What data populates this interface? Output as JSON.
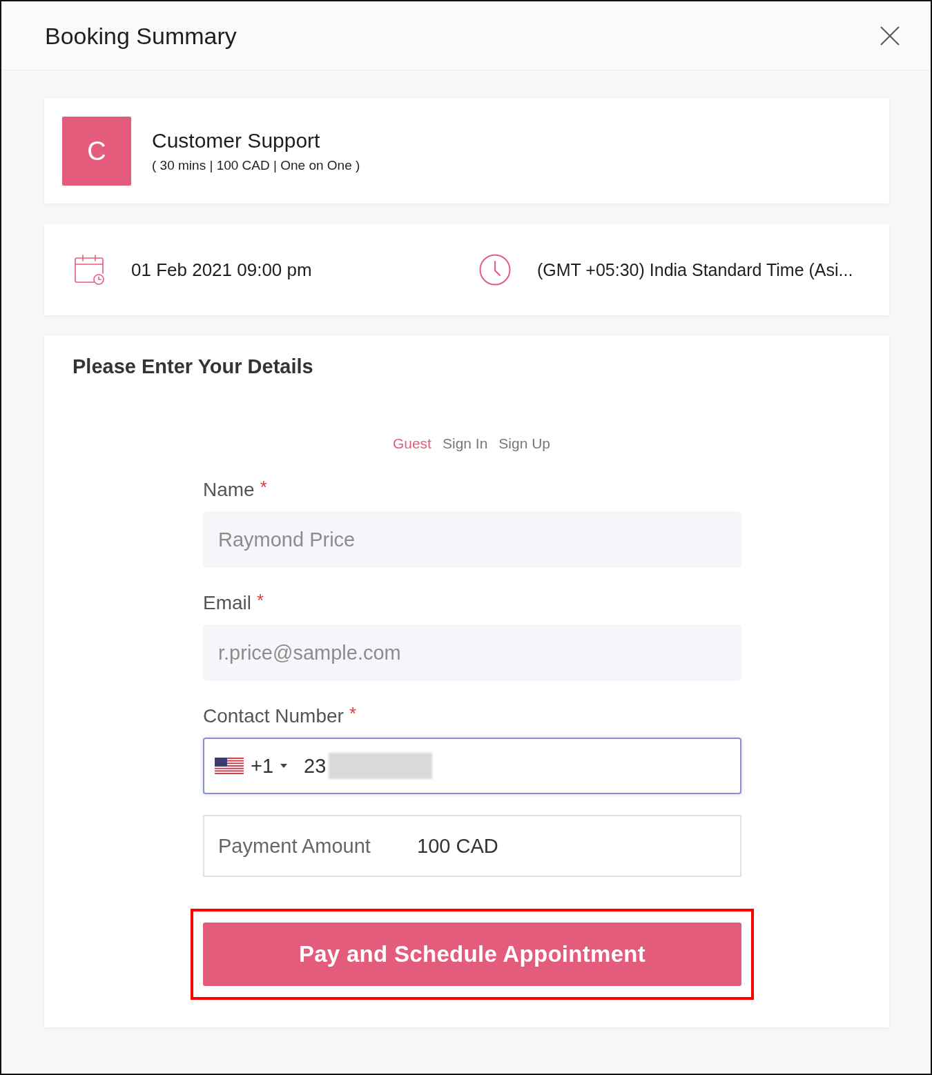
{
  "dialog": {
    "title": "Booking Summary"
  },
  "service": {
    "avatar_letter": "C",
    "name": "Customer Support",
    "details": "( 30 mins | 100 CAD | One on One )"
  },
  "schedule": {
    "date_time": "01 Feb 2021 09:00 pm",
    "timezone": "(GMT +05:30) India Standard Time (Asi..."
  },
  "details_form": {
    "heading": "Please Enter Your Details",
    "tabs": [
      {
        "label": "Guest",
        "selected": true
      },
      {
        "label": "Sign In",
        "selected": false
      },
      {
        "label": "Sign Up",
        "selected": false
      }
    ],
    "fields": [
      {
        "kind": "text",
        "label": "Name",
        "required_mark": "*",
        "placeholder": "Raymond Price"
      },
      {
        "kind": "text",
        "label": "Email",
        "required_mark": "*",
        "placeholder": "r.price@sample.com"
      },
      {
        "kind": "phone",
        "label": "Contact Number",
        "required_mark": "*",
        "dial_code": "+1",
        "value": "23",
        "focused": true,
        "redacted": true
      }
    ],
    "payment": {
      "label": "Payment Amount",
      "amount": "100 CAD"
    },
    "submit_button": {
      "label": "Pay and Schedule Appointment",
      "highlighted": true
    }
  }
}
